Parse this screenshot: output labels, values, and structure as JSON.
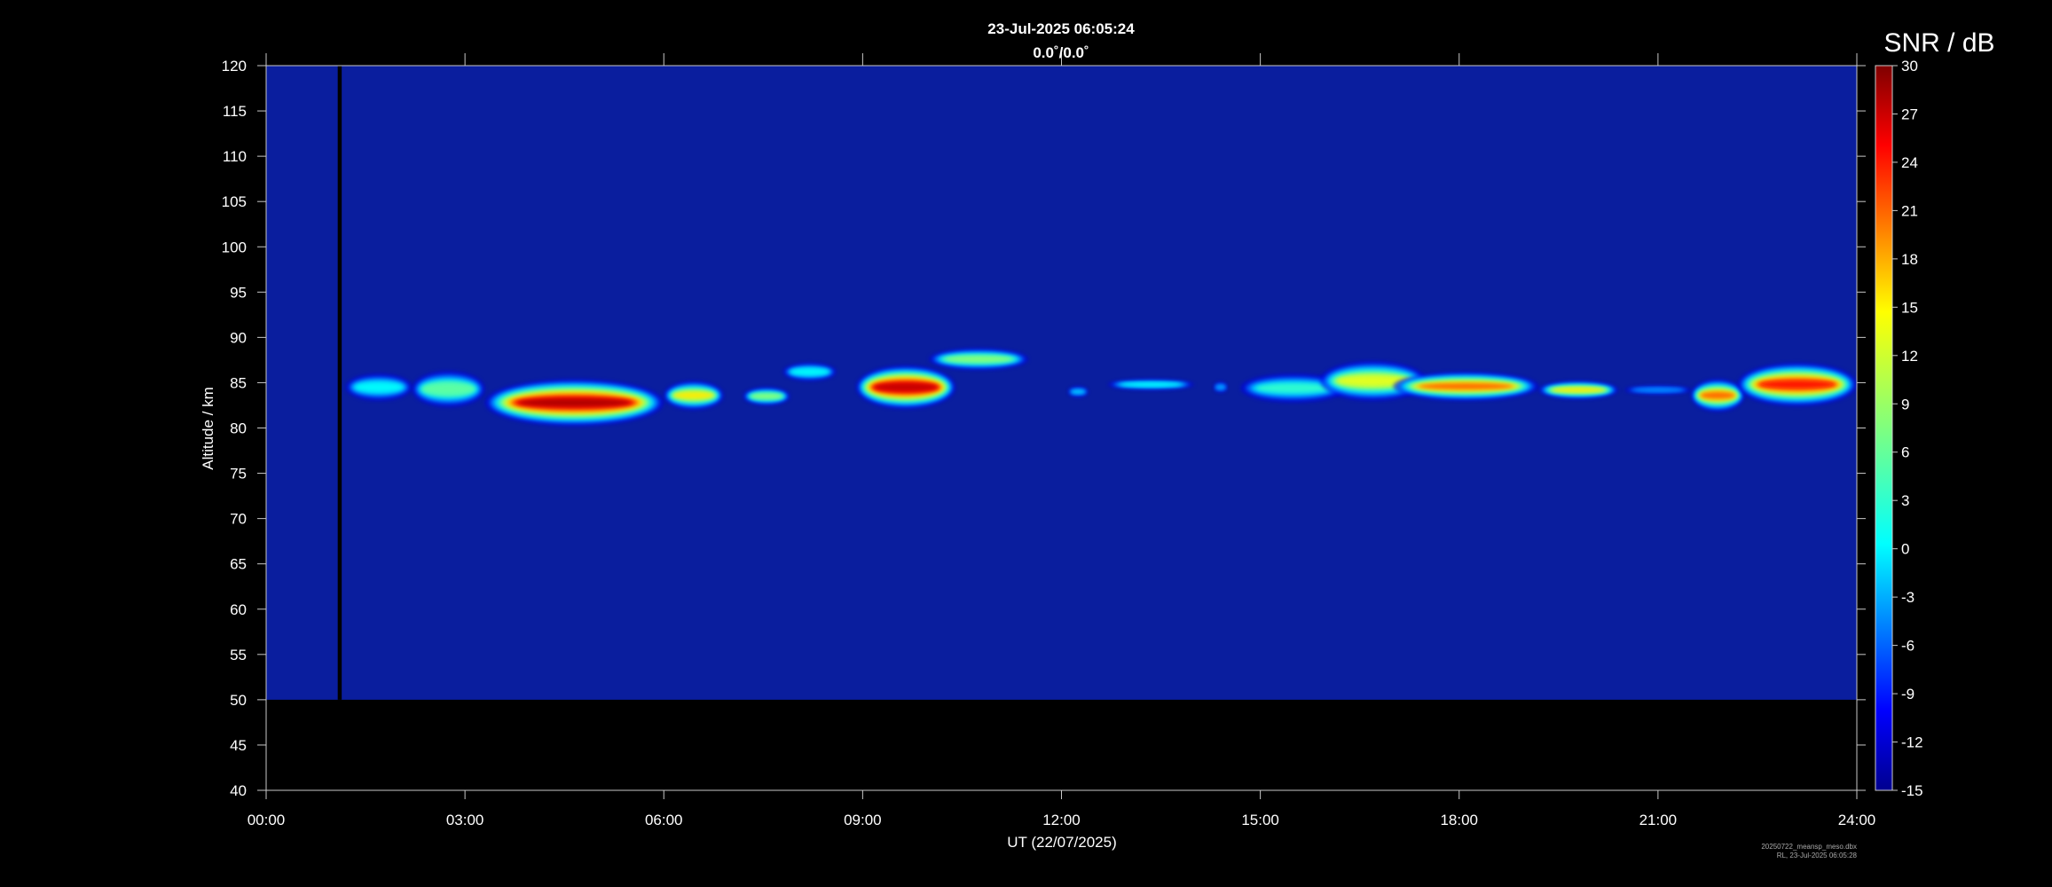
{
  "chart_data": {
    "type": "heatmap",
    "title": "23-Jul-2025 06:05:24",
    "subtitle": "0.0˚/0.0˚",
    "xlabel": "UT (22/07/2025)",
    "ylabel": "Altitude / km",
    "colorbar_label": "SNR / dB",
    "x_ticks": [
      "00:00",
      "03:00",
      "06:00",
      "09:00",
      "12:00",
      "15:00",
      "18:00",
      "21:00",
      "24:00"
    ],
    "x_range_hours": [
      0,
      24
    ],
    "y_ticks": [
      40,
      45,
      50,
      55,
      60,
      65,
      70,
      75,
      80,
      85,
      90,
      95,
      100,
      105,
      110,
      115,
      120
    ],
    "ylim": [
      40,
      120
    ],
    "data_altitude_range": [
      50,
      120
    ],
    "colorbar_ticks": [
      30,
      27,
      24,
      21,
      18,
      15,
      12,
      9,
      6,
      3,
      0,
      -3,
      -6,
      -9,
      -12,
      -15
    ],
    "colorbar_range": [
      -15,
      30
    ],
    "colormap": "jet",
    "background_color": "#000000",
    "field_color": "#0a1e9e",
    "data_gap_hours": [
      1.08,
      1.14
    ],
    "echo_layers": [
      {
        "t_start": 1.2,
        "t_end": 2.2,
        "alt_center": 84.5,
        "thickness": 1.5,
        "snr_peak": 2
      },
      {
        "t_start": 2.2,
        "t_end": 3.3,
        "alt_center": 84.3,
        "thickness": 2.0,
        "snr_peak": 6
      },
      {
        "t_start": 3.3,
        "t_end": 6.0,
        "alt_center": 82.8,
        "thickness": 2.6,
        "snr_peak": 28
      },
      {
        "t_start": 6.0,
        "t_end": 6.9,
        "alt_center": 83.6,
        "thickness": 1.6,
        "snr_peak": 14
      },
      {
        "t_start": 7.2,
        "t_end": 7.9,
        "alt_center": 83.5,
        "thickness": 1.0,
        "snr_peak": 8
      },
      {
        "t_start": 7.8,
        "t_end": 8.6,
        "alt_center": 86.2,
        "thickness": 1.0,
        "snr_peak": 2
      },
      {
        "t_start": 8.9,
        "t_end": 10.4,
        "alt_center": 84.5,
        "thickness": 2.4,
        "snr_peak": 27
      },
      {
        "t_start": 10.0,
        "t_end": 11.5,
        "alt_center": 87.6,
        "thickness": 1.2,
        "snr_peak": 8
      },
      {
        "t_start": 12.1,
        "t_end": 12.4,
        "alt_center": 84.0,
        "thickness": 0.6,
        "snr_peak": 0
      },
      {
        "t_start": 12.7,
        "t_end": 14.0,
        "alt_center": 84.8,
        "thickness": 0.6,
        "snr_peak": 2
      },
      {
        "t_start": 14.3,
        "t_end": 14.5,
        "alt_center": 84.5,
        "thickness": 0.6,
        "snr_peak": -2
      },
      {
        "t_start": 14.7,
        "t_end": 16.3,
        "alt_center": 84.4,
        "thickness": 1.6,
        "snr_peak": 4
      },
      {
        "t_start": 15.9,
        "t_end": 17.5,
        "alt_center": 85.2,
        "thickness": 2.2,
        "snr_peak": 12
      },
      {
        "t_start": 17.0,
        "t_end": 19.2,
        "alt_center": 84.6,
        "thickness": 1.6,
        "snr_peak": 20
      },
      {
        "t_start": 19.2,
        "t_end": 20.4,
        "alt_center": 84.2,
        "thickness": 1.0,
        "snr_peak": 14
      },
      {
        "t_start": 20.5,
        "t_end": 21.5,
        "alt_center": 84.2,
        "thickness": 0.5,
        "snr_peak": -3
      },
      {
        "t_start": 21.5,
        "t_end": 22.3,
        "alt_center": 83.6,
        "thickness": 1.8,
        "snr_peak": 20
      },
      {
        "t_start": 22.2,
        "t_end": 24.0,
        "alt_center": 84.8,
        "thickness": 2.4,
        "snr_peak": 24
      }
    ]
  },
  "footer": {
    "line1": "20250722_meansp_meso.dbx",
    "line2": "RL, 23-Jul-2025 06:05:28"
  }
}
